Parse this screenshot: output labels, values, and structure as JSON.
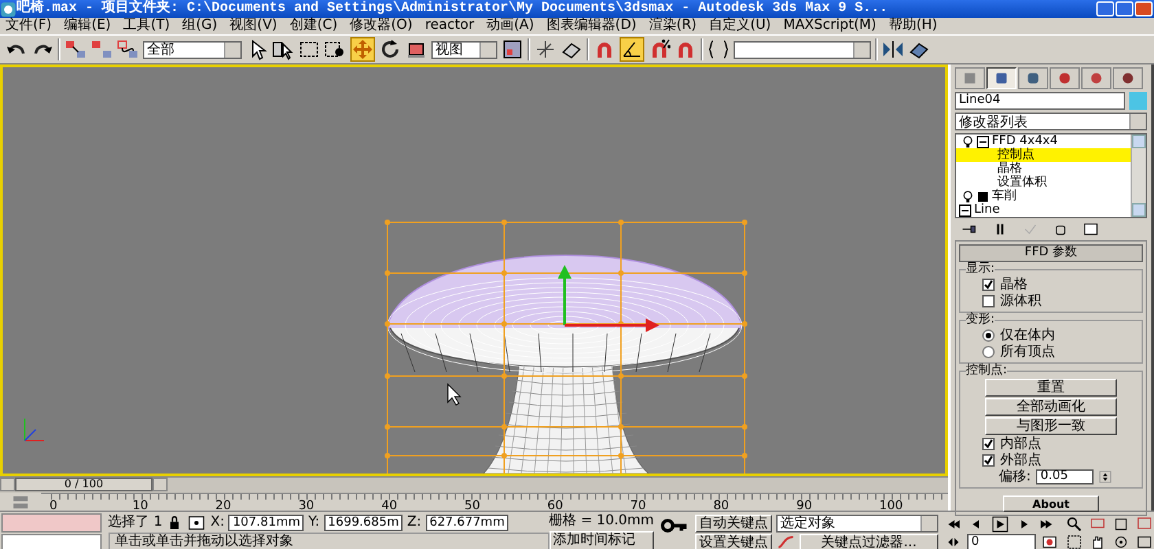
{
  "window": {
    "title": "吧椅.max  - 项目文件夹: C:\\Documents and Settings\\Administrator\\My Documents\\3dsmax  - Autodesk 3ds Max 9 S..."
  },
  "menu": [
    "文件(F)",
    "编辑(E)",
    "工具(T)",
    "组(G)",
    "视图(V)",
    "创建(C)",
    "修改器(O)",
    "reactor",
    "动画(A)",
    "图表编辑器(D)",
    "渲染(R)",
    "自定义(U)",
    "MAXScript(M)",
    "帮助(H)"
  ],
  "toolbar": {
    "selection_filter": "全部",
    "reference_coord": "视图"
  },
  "command_panel": {
    "tabs": [
      {
        "selected": false
      },
      {
        "selected": true
      },
      {
        "selected": false
      },
      {
        "selected": false
      },
      {
        "selected": false
      },
      {
        "selected": false
      }
    ],
    "object": {
      "name": "Line04",
      "color": "#4cc4e4"
    },
    "modifier_list": "修改器列表",
    "stack": [
      {
        "label": "FFD 4x4x4",
        "kind": "modifier",
        "expanded": true,
        "selected": false,
        "children": [
          {
            "label": "控制点",
            "selected": true
          },
          {
            "label": "晶格",
            "selected": false
          },
          {
            "label": "设置体积",
            "selected": false
          }
        ]
      },
      {
        "label": "车削",
        "kind": "modifier",
        "selected": false
      },
      {
        "label": "Line",
        "kind": "base",
        "expanded": true,
        "selected": false
      }
    ],
    "rollout": {
      "title": "FFD 参数",
      "groups": [
        {
          "title": "显示:",
          "controls": [
            {
              "kind": "checkbox",
              "label": "晶格",
              "checked": true
            },
            {
              "kind": "checkbox",
              "label": "源体积",
              "checked": false
            }
          ]
        },
        {
          "title": "变形:",
          "controls": [
            {
              "kind": "radio",
              "label": "仅在体内",
              "selected": true
            },
            {
              "kind": "radio",
              "label": "所有顶点",
              "selected": false
            }
          ]
        },
        {
          "title": "控制点:",
          "controls": [
            {
              "kind": "button",
              "label": "重置"
            },
            {
              "kind": "button",
              "label": "全部动画化"
            },
            {
              "kind": "button",
              "label": "与图形一致"
            },
            {
              "kind": "checkbox",
              "label": "内部点",
              "checked": true
            },
            {
              "kind": "checkbox",
              "label": "外部点",
              "checked": true
            },
            {
              "kind": "spinner",
              "label": "偏移:",
              "value": "0.05"
            }
          ]
        }
      ],
      "about": "About"
    }
  },
  "timeline": {
    "position": "0 / 100",
    "level": 0,
    "ticks": [
      "0",
      "10",
      "20",
      "30",
      "40",
      "50",
      "60",
      "70",
      "80",
      "90",
      "100"
    ]
  },
  "status": {
    "selected": "选择了 1",
    "x_label": "X:",
    "x": "107.81mm",
    "y_label": "Y:",
    "y": "1699.685m",
    "z_label": "Z:",
    "z": "627.677mm",
    "grid": "栅格 = 10.0mm",
    "prompt": "单击或单击并拖动以选择对象",
    "add_time_tag": "添加时间标记",
    "auto_key": "自动关键点",
    "set_key": "设置关键点",
    "key_mode": "选定对象",
    "key_filters": "关键点过滤器...",
    "frame": "0"
  }
}
